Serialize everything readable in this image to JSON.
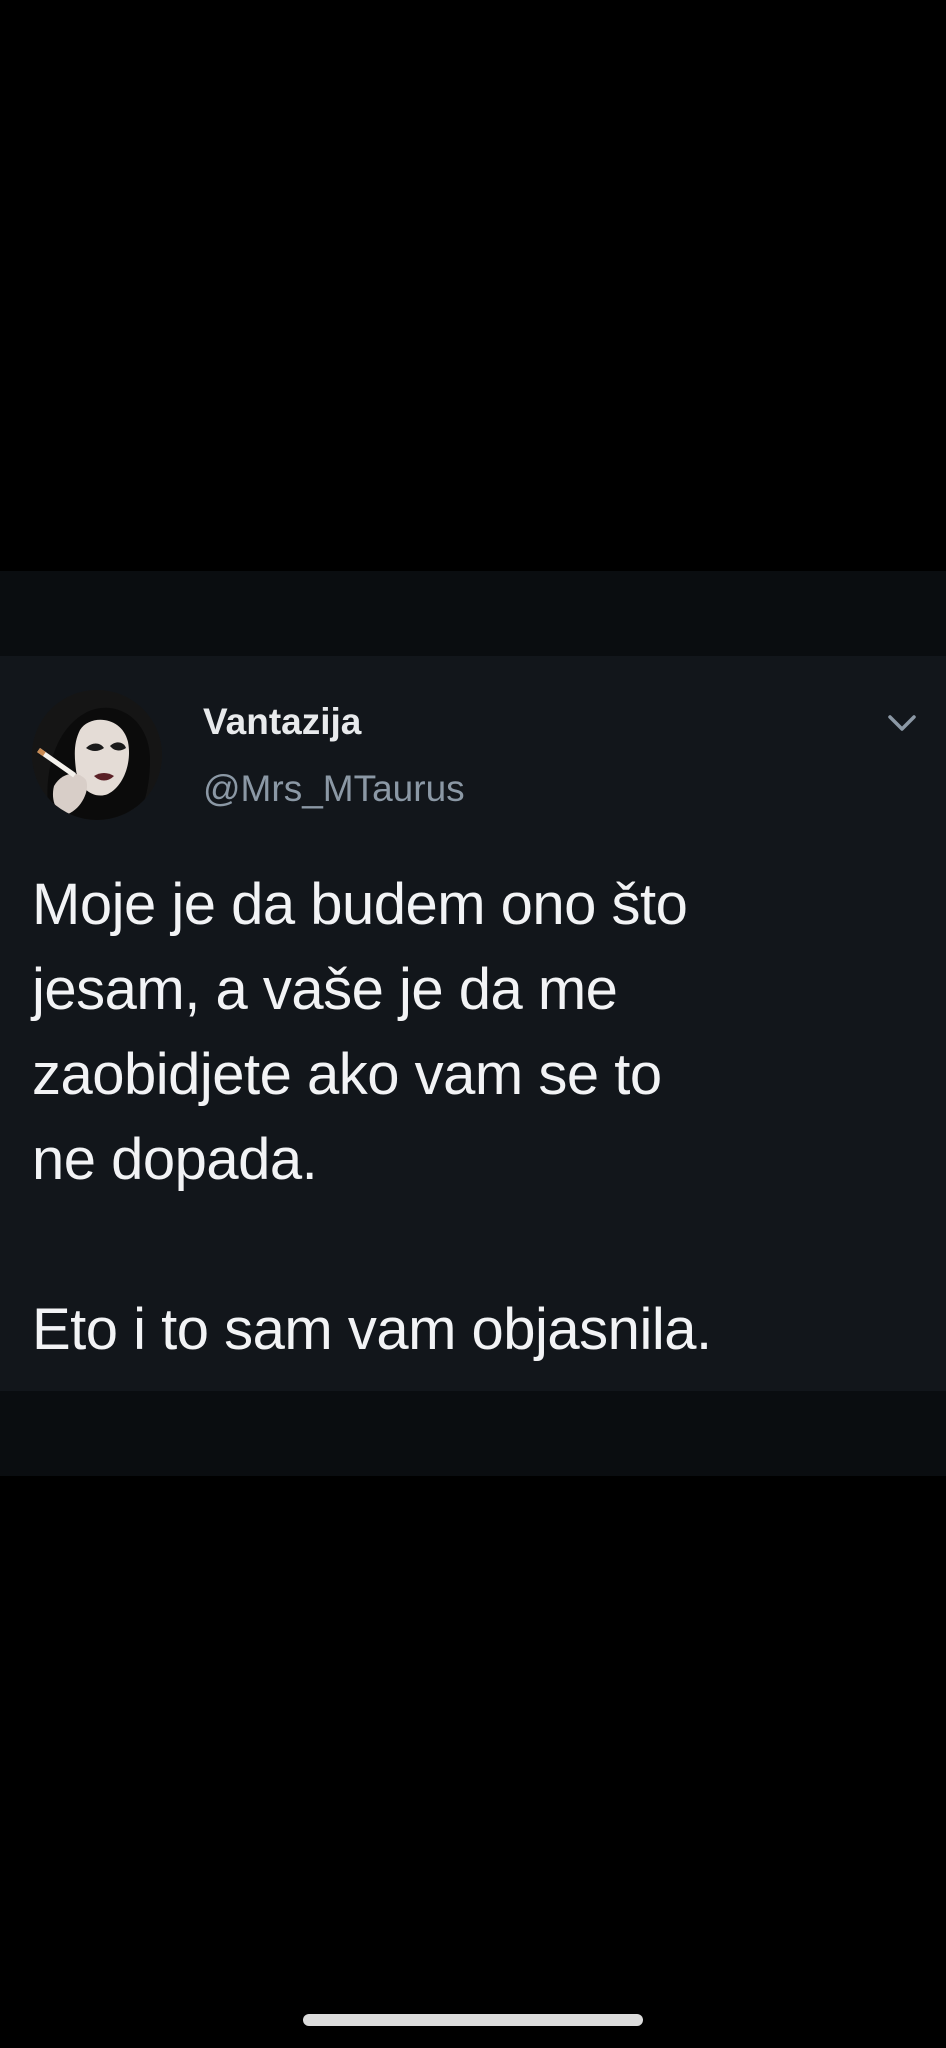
{
  "tweet": {
    "author": {
      "display_name": "Vantazija",
      "handle": "@Mrs_MTaurus",
      "avatar_icon": "profile-photo-woman-icon"
    },
    "menu_icon": "chevron-down-icon",
    "text_lines": [
      "Moje je da budem ono što",
      "jesam, a vaše je da me",
      "zaobidjete ako vam se to",
      "ne dopada."
    ],
    "text_line_2": "Eto i to sam vam objasnila."
  },
  "colors": {
    "background": "#000000",
    "card_background": "#12161b",
    "text_primary": "#f2f3f5",
    "text_secondary": "#8b98a5"
  }
}
